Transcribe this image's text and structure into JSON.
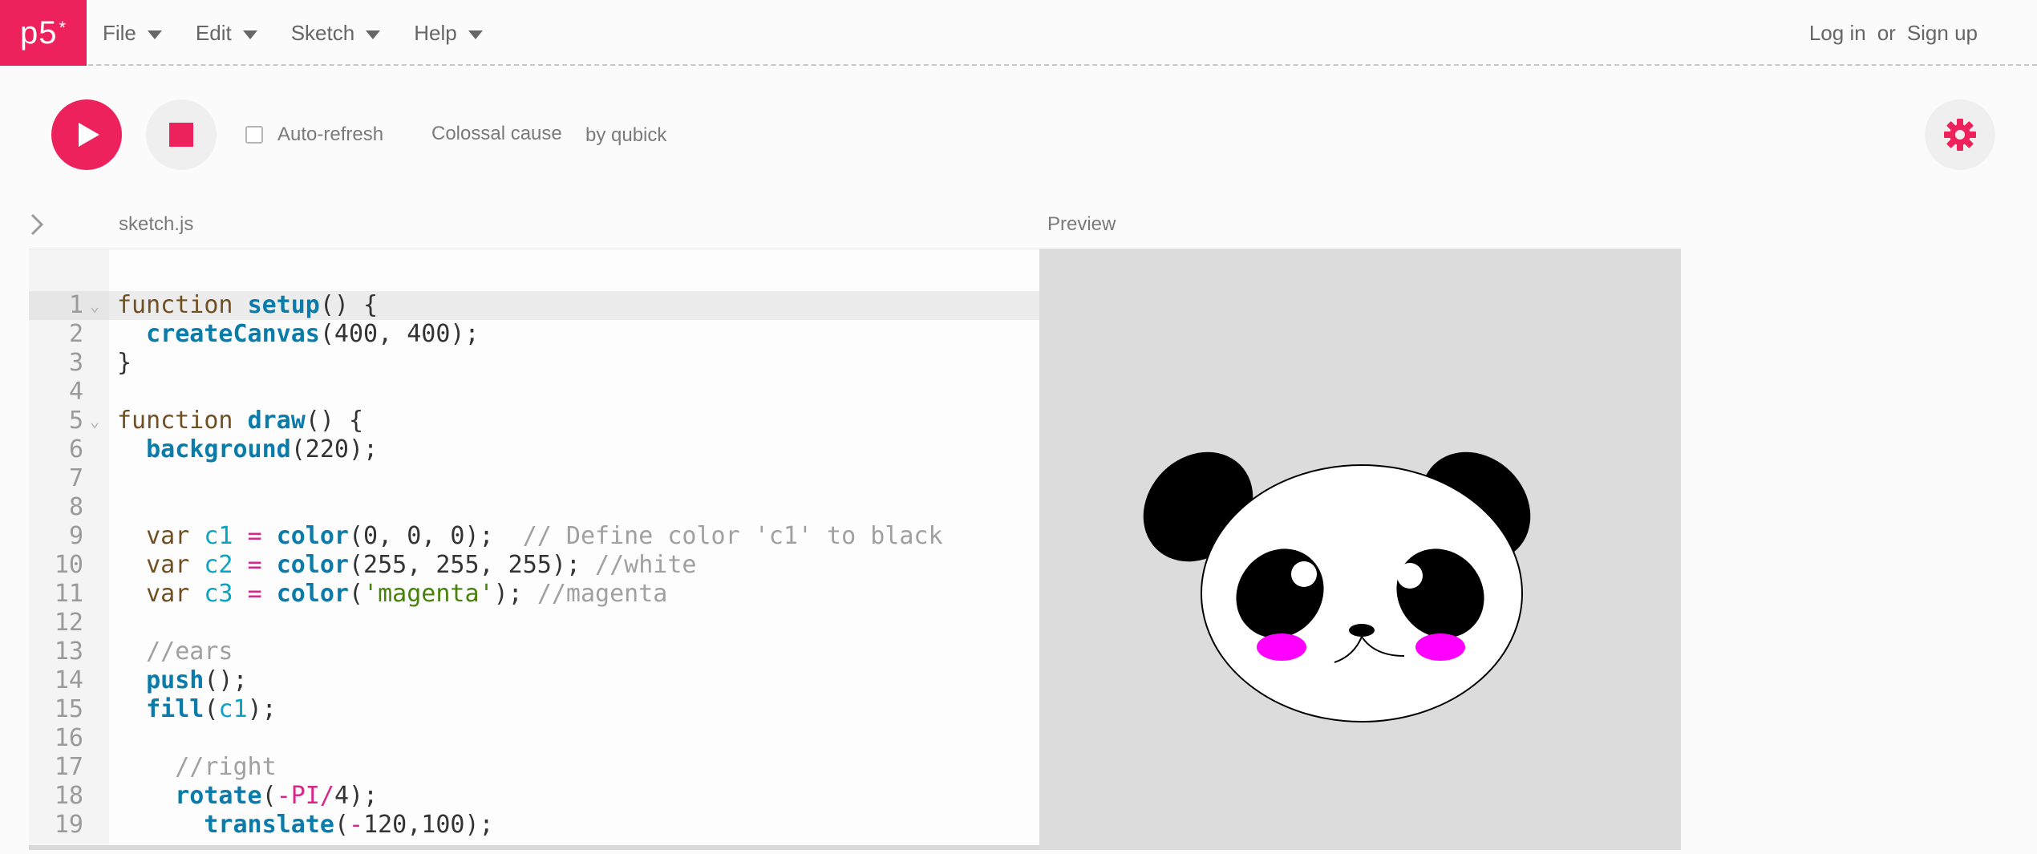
{
  "nav": {
    "logo": "p5",
    "logo_mark": "*",
    "menus": [
      "File",
      "Edit",
      "Sketch",
      "Help"
    ],
    "login": "Log in",
    "or": "or",
    "signup": "Sign up"
  },
  "toolbar": {
    "autorefresh_label": "Auto-refresh",
    "sketch_name": "Colossal cause",
    "sketch_owner": "by qubick"
  },
  "editor": {
    "file_name": "sketch.js",
    "preview_label": "Preview",
    "active_line": 1,
    "lines": [
      "function setup() {",
      "  createCanvas(400, 400);",
      "}",
      "",
      "function draw() {",
      "  background(220);",
      "",
      "",
      "  var c1 = color(0, 0, 0);  // Define color 'c1' to black",
      "  var c2 = color(255, 255, 255); //white",
      "  var c3 = color('magenta'); //magenta",
      "",
      "  //ears",
      "  push();",
      "  fill(c1);",
      "",
      "    //right",
      "    rotate(-PI/4);",
      "      translate(-120,100);"
    ]
  },
  "preview": {
    "background": "#dcdcdc",
    "colors": {
      "c1": "#000000",
      "c2": "#ffffff",
      "c3": "#ff00ff"
    }
  },
  "colors": {
    "accent": "#ed225d",
    "icons": [
      "play-icon",
      "stop-icon",
      "gear-icon",
      "chevron-right-icon",
      "chevron-down-icon"
    ]
  }
}
